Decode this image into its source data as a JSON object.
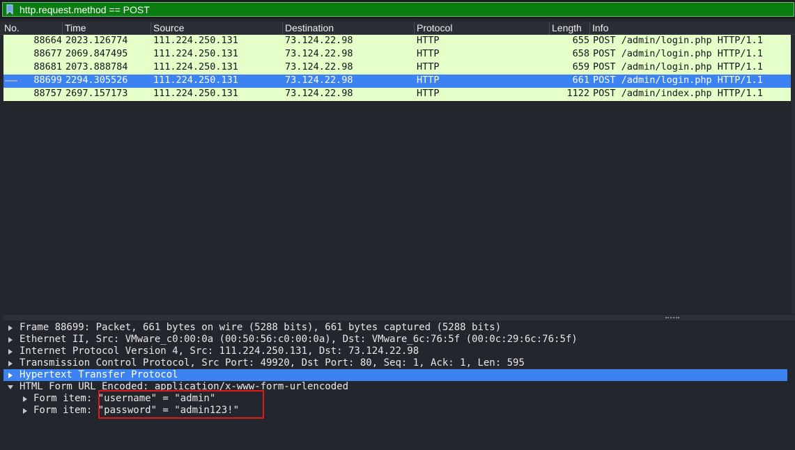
{
  "filter": {
    "value": "http.request.method == POST",
    "icon": "bookmark-icon"
  },
  "columns": [
    "No.",
    "Time",
    "Source",
    "Destination",
    "Protocol",
    "Length",
    "Info"
  ],
  "packets": [
    {
      "no": "88664",
      "time": "2023.126774",
      "source": "111.224.250.131",
      "destination": "73.124.22.98",
      "protocol": "HTTP",
      "length": "655",
      "info": "POST /admin/login.php HTTP/1.1",
      "selected": false
    },
    {
      "no": "88677",
      "time": "2069.847495",
      "source": "111.224.250.131",
      "destination": "73.124.22.98",
      "protocol": "HTTP",
      "length": "658",
      "info": "POST /admin/login.php HTTP/1.1",
      "selected": false
    },
    {
      "no": "88681",
      "time": "2073.888784",
      "source": "111.224.250.131",
      "destination": "73.124.22.98",
      "protocol": "HTTP",
      "length": "659",
      "info": "POST /admin/login.php HTTP/1.1",
      "selected": false
    },
    {
      "no": "88699",
      "time": "2294.305526",
      "source": "111.224.250.131",
      "destination": "73.124.22.98",
      "protocol": "HTTP",
      "length": "661",
      "info": "POST /admin/login.php HTTP/1.1",
      "selected": true
    },
    {
      "no": "88757",
      "time": "2697.157173",
      "source": "111.224.250.131",
      "destination": "73.124.22.98",
      "protocol": "HTTP",
      "length": "1122",
      "info": "POST /admin/index.php HTTP/1.1",
      "selected": false
    }
  ],
  "details": [
    {
      "text": "Frame 88699: Packet, 661 bytes on wire (5288 bits), 661 bytes captured (5288 bits)",
      "expanded": false,
      "indent": 0,
      "selected": false
    },
    {
      "text": "Ethernet II, Src: VMware_c0:00:0a (00:50:56:c0:00:0a), Dst: VMware_6c:76:5f (00:0c:29:6c:76:5f)",
      "expanded": false,
      "indent": 0,
      "selected": false
    },
    {
      "text": "Internet Protocol Version 4, Src: 111.224.250.131, Dst: 73.124.22.98",
      "expanded": false,
      "indent": 0,
      "selected": false
    },
    {
      "text": "Transmission Control Protocol, Src Port: 49920, Dst Port: 80, Seq: 1, Ack: 1, Len: 595",
      "expanded": false,
      "indent": 0,
      "selected": false
    },
    {
      "text": "Hypertext Transfer Protocol",
      "expanded": false,
      "indent": 0,
      "selected": true
    },
    {
      "text": "HTML Form URL Encoded: application/x-www-form-urlencoded",
      "expanded": true,
      "indent": 0,
      "selected": false
    },
    {
      "text": "Form item: \"username\" = \"admin\"",
      "expanded": false,
      "indent": 1,
      "selected": false
    },
    {
      "text": "Form item: \"password\" = \"admin123!\"",
      "expanded": false,
      "indent": 1,
      "selected": false
    }
  ],
  "colors": {
    "row_bg": "#e4ffc7",
    "selected_bg": "#3c82f0",
    "filter_bg": "#0a7d12",
    "annotation": "#e01818"
  }
}
